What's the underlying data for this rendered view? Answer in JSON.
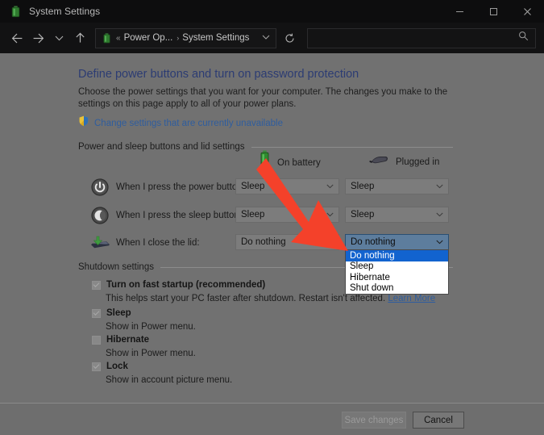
{
  "window": {
    "title": "System Settings",
    "title_icon": "battery-icon",
    "controls": {
      "minimize": "minimize-icon",
      "maximize": "maximize-icon",
      "close": "close-icon"
    }
  },
  "addressbar": {
    "back": "back-arrow-icon",
    "forward": "forward-arrow-icon",
    "recent": "chevron-down-icon",
    "up": "up-arrow-icon",
    "breadcrumb": {
      "icon": "battery-icon",
      "overflow": "«",
      "parent": "Power Op...",
      "separator": "›",
      "current": "System Settings",
      "dropdown": "chevron-down-icon"
    },
    "refresh": "refresh-icon",
    "search": {
      "value": "",
      "placeholder": "",
      "icon": "search-icon"
    }
  },
  "content": {
    "heading": "Define power buttons and turn on password protection",
    "description": "Choose the power settings that you want for your computer. The changes you make to the settings on this page apply to all of your power plans.",
    "admin_link": {
      "icon": "shield-icon",
      "label": "Change settings that are currently unavailable"
    },
    "power_group": {
      "title": "Power and sleep buttons and lid settings",
      "columns": [
        {
          "icon": "battery-icon",
          "label": "On battery"
        },
        {
          "icon": "plug-icon",
          "label": "Plugged in"
        }
      ],
      "rows": [
        {
          "icon": "power-button-icon",
          "label": "When I press the power button:",
          "on_battery": "Sleep",
          "plugged_in": "Sleep"
        },
        {
          "icon": "sleep-moon-icon",
          "label": "When I press the sleep button:",
          "on_battery": "Sleep",
          "plugged_in": "Sleep"
        },
        {
          "icon": "laptop-lid-icon",
          "label": "When I close the lid:",
          "on_battery": "Do nothing",
          "plugged_in": "Do nothing"
        }
      ],
      "open_dropdown": {
        "options": [
          "Do nothing",
          "Sleep",
          "Hibernate",
          "Shut down"
        ],
        "selected": "Do nothing"
      }
    },
    "shutdown_group": {
      "title": "Shutdown settings",
      "items": [
        {
          "label": "Turn on fast startup (recommended)",
          "checked": true,
          "description": "This helps start your PC faster after shutdown. Restart isn't affected.",
          "link": "Learn More"
        },
        {
          "label": "Sleep",
          "checked": true,
          "description": "Show in Power menu.",
          "link": ""
        },
        {
          "label": "Hibernate",
          "checked": false,
          "description": "Show in Power menu.",
          "link": ""
        },
        {
          "label": "Lock",
          "checked": true,
          "description": "Show in account picture menu.",
          "link": ""
        }
      ]
    }
  },
  "footer": {
    "save_label": "Save changes",
    "cancel_label": "Cancel"
  },
  "annotation": {
    "arrow_color": "#f4412a"
  },
  "colors": {
    "heading": "#2c3c73",
    "link": "#2f5d9e",
    "highlight": "#1263cf",
    "page_bg": "#717171",
    "titlebar_bg": "#0d0d0e"
  }
}
